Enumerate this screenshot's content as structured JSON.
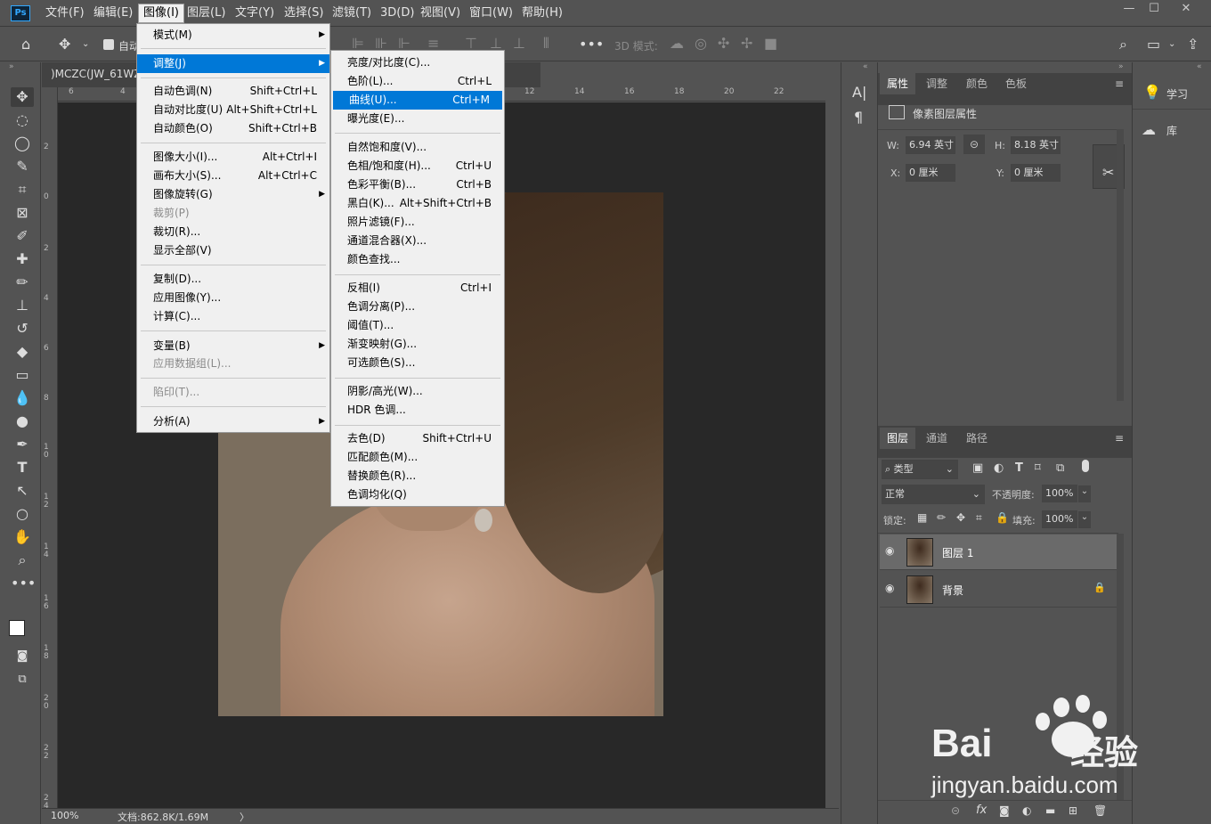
{
  "app": {
    "icon_text": "Ps"
  },
  "menubar": {
    "items": [
      "文件(F)",
      "编辑(E)",
      "图像(I)",
      "图层(L)",
      "文字(Y)",
      "选择(S)",
      "滤镜(T)",
      "3D(D)",
      "视图(V)",
      "窗口(W)",
      "帮助(H)"
    ],
    "window_controls": [
      "—",
      "☐",
      "✕"
    ]
  },
  "options_bar": {
    "auto_label": "自动",
    "mode_3d": "3D 模式:"
  },
  "document": {
    "tab": ")MCZC(JW_61WZ)"
  },
  "ruler": {
    "top": [
      "6",
      "4",
      "12",
      "14",
      "16",
      "18",
      "20",
      "22"
    ],
    "left": [
      "2",
      "0",
      "2",
      "4",
      "6",
      "8",
      "1\n0",
      "1\n2",
      "1\n4",
      "1\n6",
      "1\n8",
      "2\n0",
      "2\n2",
      "2\n4"
    ]
  },
  "status": {
    "zoom": "100%",
    "doc": "文档:862.8K/1.69M",
    "arrow": "〉"
  },
  "image_menu": {
    "items": [
      {
        "label": "模式(M)",
        "arrow": "▶"
      },
      {
        "label": "调整(J)",
        "arrow": "▶"
      },
      {
        "label": "自动色调(N)",
        "shortcut": "Shift+Ctrl+L"
      },
      {
        "label": "自动对比度(U)",
        "shortcut": "Alt+Shift+Ctrl+L"
      },
      {
        "label": "自动颜色(O)",
        "shortcut": "Shift+Ctrl+B"
      },
      {
        "label": "图像大小(I)...",
        "shortcut": "Alt+Ctrl+I"
      },
      {
        "label": "画布大小(S)...",
        "shortcut": "Alt+Ctrl+C"
      },
      {
        "label": "图像旋转(G)",
        "arrow": "▶"
      },
      {
        "label": "裁剪(P)"
      },
      {
        "label": "裁切(R)..."
      },
      {
        "label": "显示全部(V)"
      },
      {
        "label": "复制(D)..."
      },
      {
        "label": "应用图像(Y)..."
      },
      {
        "label": "计算(C)..."
      },
      {
        "label": "变量(B)",
        "arrow": "▶"
      },
      {
        "label": "应用数据组(L)..."
      },
      {
        "label": "陷印(T)..."
      },
      {
        "label": "分析(A)",
        "arrow": "▶"
      }
    ]
  },
  "adjust_menu": {
    "items": [
      {
        "label": "亮度/对比度(C)..."
      },
      {
        "label": "色阶(L)...",
        "shortcut": "Ctrl+L"
      },
      {
        "label": "曲线(U)...",
        "shortcut": "Ctrl+M"
      },
      {
        "label": "曝光度(E)..."
      },
      {
        "label": "自然饱和度(V)..."
      },
      {
        "label": "色相/饱和度(H)...",
        "shortcut": "Ctrl+U"
      },
      {
        "label": "色彩平衡(B)...",
        "shortcut": "Ctrl+B"
      },
      {
        "label": "黑白(K)...",
        "shortcut": "Alt+Shift+Ctrl+B"
      },
      {
        "label": "照片滤镜(F)..."
      },
      {
        "label": "通道混合器(X)..."
      },
      {
        "label": "颜色查找..."
      },
      {
        "label": "反相(I)",
        "shortcut": "Ctrl+I"
      },
      {
        "label": "色调分离(P)..."
      },
      {
        "label": "阈值(T)..."
      },
      {
        "label": "渐变映射(G)..."
      },
      {
        "label": "可选颜色(S)..."
      },
      {
        "label": "阴影/高光(W)..."
      },
      {
        "label": "HDR 色调..."
      },
      {
        "label": "去色(D)",
        "shortcut": "Shift+Ctrl+U"
      },
      {
        "label": "匹配颜色(M)..."
      },
      {
        "label": "替换颜色(R)..."
      },
      {
        "label": "色调均化(Q)"
      }
    ]
  },
  "properties": {
    "tabs": [
      "属性",
      "调整",
      "颜色",
      "色板"
    ],
    "title": "像素图层属性",
    "w_label": "W:",
    "w_value": "6.94 英寸",
    "h_label": "H:",
    "h_value": "8.18 英寸",
    "x_label": "X:",
    "x_value": "0 厘米",
    "y_label": "Y:",
    "y_value": "0 厘米"
  },
  "layers": {
    "tabs": [
      "图层",
      "通道",
      "路径"
    ],
    "filter": "类型",
    "blend": "正常",
    "opacity_label": "不透明度:",
    "opacity": "100%",
    "lock_label": "锁定:",
    "fill_label": "填充:",
    "fill": "100%",
    "rows": [
      {
        "name": "图层 1"
      },
      {
        "name": "背景"
      }
    ]
  },
  "right_panel": {
    "learn": "学习",
    "library": "库"
  },
  "watermark": {
    "brand": "Bai",
    "brand2": "经验",
    "url": "jingyan.baidu.com"
  }
}
